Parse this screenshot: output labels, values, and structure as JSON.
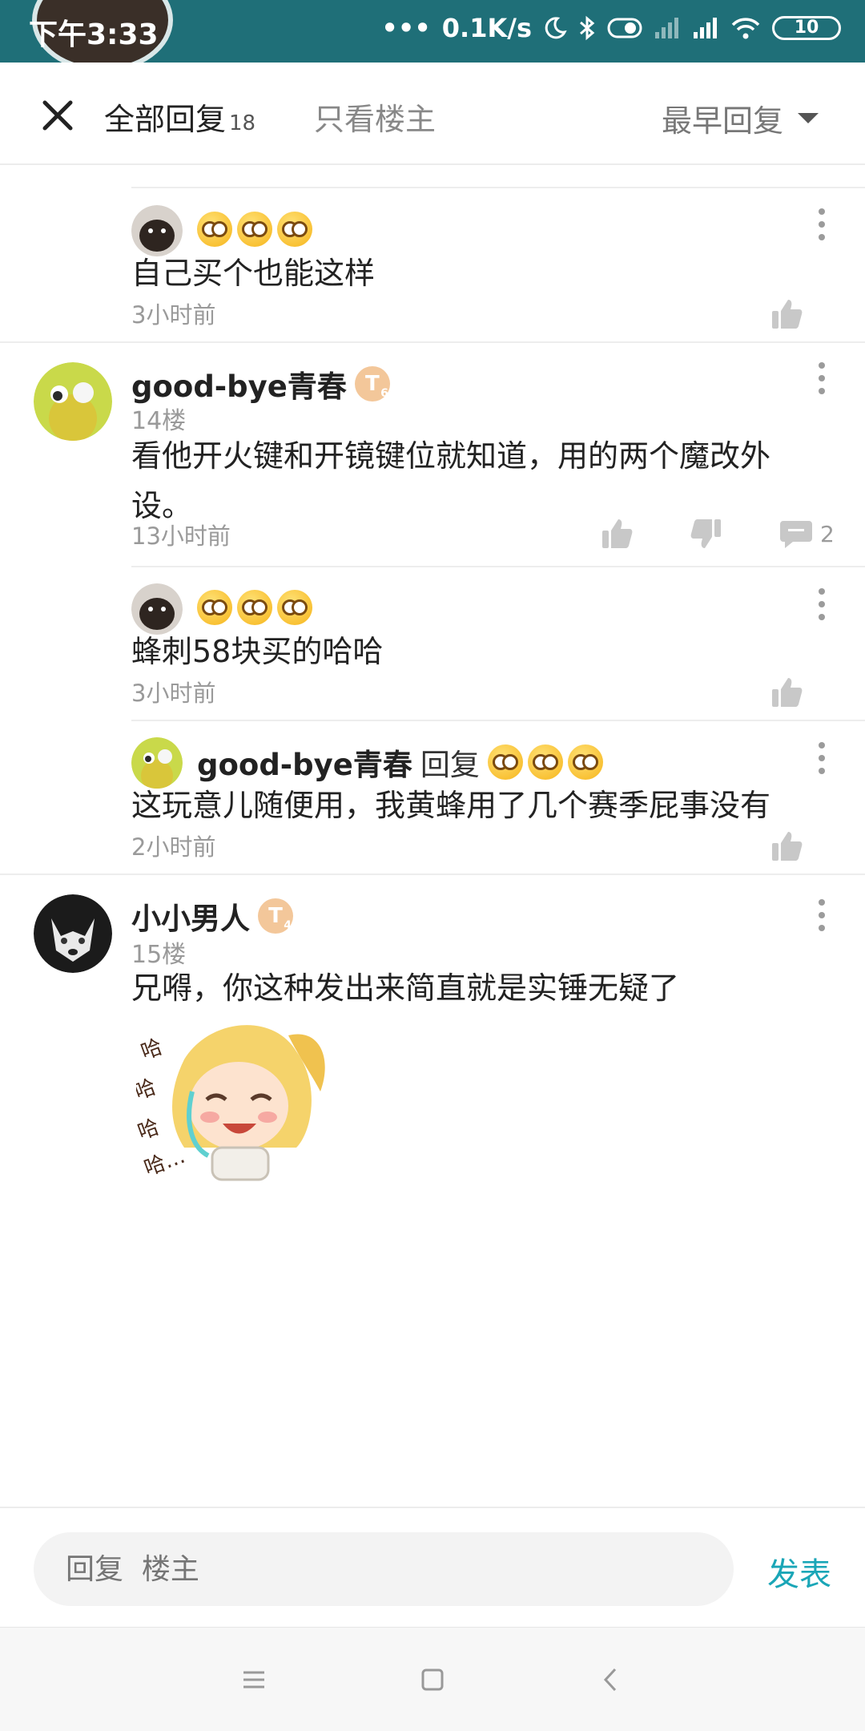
{
  "status": {
    "time": "下午3:33",
    "speed": "0.1K/s",
    "battery": "10"
  },
  "header": {
    "tab_all": "全部回复",
    "tab_all_count": "18",
    "tab_owner": "只看楼主",
    "sort": "最早回复"
  },
  "reply_a": {
    "body": "自己买个也能这样",
    "time": "3小时前"
  },
  "comment14": {
    "name": "good-bye青春",
    "badge": "T",
    "badge_level": "6",
    "floor": "14楼",
    "body": "看他开火键和开镜键位就知道，用的两个魔改外设。",
    "time": "13小时前",
    "reply_count": "2"
  },
  "reply_b": {
    "body": "蜂刺58块买的哈哈",
    "time": "3小时前"
  },
  "reply_c": {
    "name": "good-bye青春",
    "reply_word": "回复",
    "body": "这玩意儿随便用，我黄蜂用了几个赛季屁事没有",
    "time": "2小时前"
  },
  "comment15": {
    "name": "小小男人",
    "badge": "T",
    "badge_level": "4",
    "floor": "15楼",
    "body": "兄嘚，你这种发出来简直就是实锤无疑了"
  },
  "replybar": {
    "placeholder": "回复  楼主",
    "send": "发表"
  },
  "colors": {
    "accent": "#1aa6b7",
    "statusbar": "#1f6f78",
    "badge": "#f3c79a"
  },
  "icons": [
    "close-icon",
    "chevron-down-icon",
    "more-icon",
    "like-icon",
    "dislike-icon",
    "comment-icon",
    "menu-icon",
    "home-icon",
    "back-icon"
  ]
}
